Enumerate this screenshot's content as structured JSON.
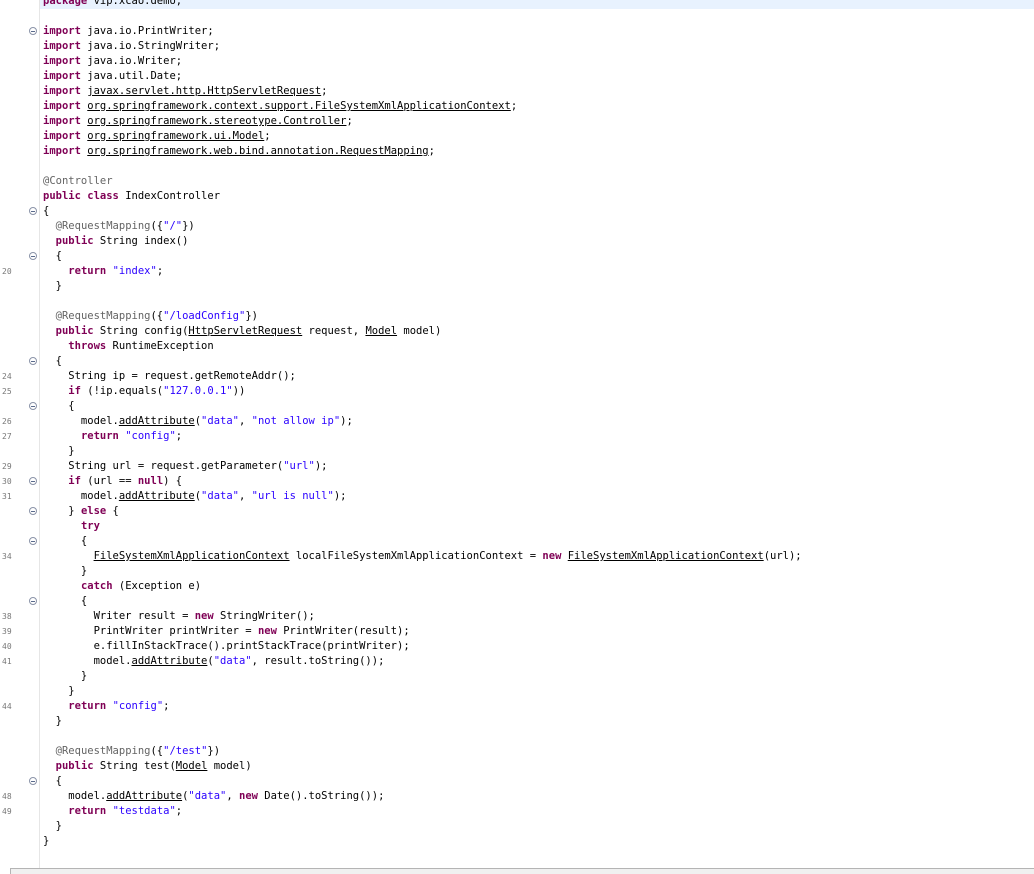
{
  "editor": {
    "lines": [
      {
        "n": "",
        "fold": false,
        "segs": [
          [
            "kw",
            "package"
          ],
          [
            "t",
            " vip.xcao.demo;"
          ]
        ]
      },
      {
        "n": "",
        "fold": false,
        "segs": []
      },
      {
        "n": "",
        "fold": true,
        "segs": [
          [
            "kw",
            "import"
          ],
          [
            "t",
            " java.io.PrintWriter;"
          ]
        ]
      },
      {
        "n": "",
        "fold": false,
        "segs": [
          [
            "kw",
            "import"
          ],
          [
            "t",
            " java.io.StringWriter;"
          ]
        ]
      },
      {
        "n": "",
        "fold": false,
        "segs": [
          [
            "kw",
            "import"
          ],
          [
            "t",
            " java.io.Writer;"
          ]
        ]
      },
      {
        "n": "",
        "fold": false,
        "segs": [
          [
            "kw",
            "import"
          ],
          [
            "t",
            " java.util.Date;"
          ]
        ]
      },
      {
        "n": "",
        "fold": false,
        "segs": [
          [
            "kw",
            "import"
          ],
          [
            "t",
            " "
          ],
          [
            "u",
            "javax.servlet.http.HttpServletRequest"
          ],
          [
            "t",
            ";"
          ]
        ]
      },
      {
        "n": "",
        "fold": false,
        "segs": [
          [
            "kw",
            "import"
          ],
          [
            "t",
            " "
          ],
          [
            "u",
            "org.springframework.context.support.FileSystemXmlApplicationContext"
          ],
          [
            "t",
            ";"
          ]
        ]
      },
      {
        "n": "",
        "fold": false,
        "segs": [
          [
            "kw",
            "import"
          ],
          [
            "t",
            " "
          ],
          [
            "u",
            "org.springframework.stereotype.Controller"
          ],
          [
            "t",
            ";"
          ]
        ]
      },
      {
        "n": "",
        "fold": false,
        "segs": [
          [
            "kw",
            "import"
          ],
          [
            "t",
            " "
          ],
          [
            "u",
            "org.springframework.ui.Model"
          ],
          [
            "t",
            ";"
          ]
        ]
      },
      {
        "n": "",
        "fold": false,
        "segs": [
          [
            "kw",
            "import"
          ],
          [
            "t",
            " "
          ],
          [
            "u",
            "org.springframework.web.bind.annotation.RequestMapping"
          ],
          [
            "t",
            ";"
          ]
        ]
      },
      {
        "n": "",
        "fold": false,
        "segs": []
      },
      {
        "n": "",
        "fold": false,
        "segs": [
          [
            "ann",
            "@Controller"
          ]
        ]
      },
      {
        "n": "",
        "fold": false,
        "segs": [
          [
            "kw",
            "public"
          ],
          [
            "t",
            " "
          ],
          [
            "kw",
            "class"
          ],
          [
            "t",
            " IndexController"
          ]
        ]
      },
      {
        "n": "",
        "fold": true,
        "segs": [
          [
            "t",
            "{"
          ]
        ]
      },
      {
        "n": "",
        "fold": false,
        "segs": [
          [
            "t",
            "  "
          ],
          [
            "ann",
            "@RequestMapping"
          ],
          [
            "t",
            "({"
          ],
          [
            "str",
            "\"/\""
          ],
          [
            "t",
            "})"
          ]
        ]
      },
      {
        "n": "",
        "fold": false,
        "segs": [
          [
            "t",
            "  "
          ],
          [
            "kw",
            "public"
          ],
          [
            "t",
            " String index()"
          ]
        ]
      },
      {
        "n": "",
        "fold": true,
        "segs": [
          [
            "t",
            "  {"
          ]
        ]
      },
      {
        "n": "20",
        "fold": false,
        "segs": [
          [
            "t",
            "    "
          ],
          [
            "kw",
            "return"
          ],
          [
            "t",
            " "
          ],
          [
            "str",
            "\"index\""
          ],
          [
            "t",
            ";"
          ]
        ]
      },
      {
        "n": "",
        "fold": false,
        "segs": [
          [
            "t",
            "  }"
          ]
        ]
      },
      {
        "n": "",
        "fold": false,
        "segs": []
      },
      {
        "n": "",
        "fold": false,
        "segs": [
          [
            "t",
            "  "
          ],
          [
            "ann",
            "@RequestMapping"
          ],
          [
            "t",
            "({"
          ],
          [
            "str",
            "\"/loadConfig\""
          ],
          [
            "t",
            "})"
          ]
        ]
      },
      {
        "n": "",
        "fold": false,
        "segs": [
          [
            "t",
            "  "
          ],
          [
            "kw",
            "public"
          ],
          [
            "t",
            " String config("
          ],
          [
            "u",
            "HttpServletRequest"
          ],
          [
            "t",
            " request, "
          ],
          [
            "u",
            "Model"
          ],
          [
            "t",
            " model)"
          ]
        ]
      },
      {
        "n": "",
        "fold": false,
        "segs": [
          [
            "t",
            "    "
          ],
          [
            "kw",
            "throws"
          ],
          [
            "t",
            " RuntimeException"
          ]
        ]
      },
      {
        "n": "",
        "fold": true,
        "segs": [
          [
            "t",
            "  {"
          ]
        ]
      },
      {
        "n": "24",
        "fold": false,
        "segs": [
          [
            "t",
            "    String ip = request.getRemoteAddr();"
          ]
        ]
      },
      {
        "n": "25",
        "fold": false,
        "segs": [
          [
            "t",
            "    "
          ],
          [
            "kw",
            "if"
          ],
          [
            "t",
            " (!ip.equals("
          ],
          [
            "str",
            "\"127.0.0.1\""
          ],
          [
            "t",
            "))"
          ]
        ]
      },
      {
        "n": "",
        "fold": true,
        "segs": [
          [
            "t",
            "    {"
          ]
        ]
      },
      {
        "n": "26",
        "fold": false,
        "segs": [
          [
            "t",
            "      model."
          ],
          [
            "u",
            "addAttribute"
          ],
          [
            "t",
            "("
          ],
          [
            "str",
            "\"data\""
          ],
          [
            "t",
            ", "
          ],
          [
            "str",
            "\"not allow ip\""
          ],
          [
            "t",
            ");"
          ]
        ]
      },
      {
        "n": "27",
        "fold": false,
        "segs": [
          [
            "t",
            "      "
          ],
          [
            "kw",
            "return"
          ],
          [
            "t",
            " "
          ],
          [
            "str",
            "\"config\""
          ],
          [
            "t",
            ";"
          ]
        ]
      },
      {
        "n": "",
        "fold": false,
        "segs": [
          [
            "t",
            "    }"
          ]
        ]
      },
      {
        "n": "29",
        "fold": false,
        "segs": [
          [
            "t",
            "    String url = request.getParameter("
          ],
          [
            "str",
            "\"url\""
          ],
          [
            "t",
            ");"
          ]
        ]
      },
      {
        "n": "30",
        "fold": true,
        "segs": [
          [
            "t",
            "    "
          ],
          [
            "kw",
            "if"
          ],
          [
            "t",
            " (url == "
          ],
          [
            "kw",
            "null"
          ],
          [
            "t",
            ") {"
          ]
        ]
      },
      {
        "n": "31",
        "fold": false,
        "segs": [
          [
            "t",
            "      model."
          ],
          [
            "u",
            "addAttribute"
          ],
          [
            "t",
            "("
          ],
          [
            "str",
            "\"data\""
          ],
          [
            "t",
            ", "
          ],
          [
            "str",
            "\"url is null\""
          ],
          [
            "t",
            ");"
          ]
        ]
      },
      {
        "n": "",
        "fold": true,
        "segs": [
          [
            "t",
            "    } "
          ],
          [
            "kw",
            "else"
          ],
          [
            "t",
            " {"
          ]
        ]
      },
      {
        "n": "",
        "fold": false,
        "segs": [
          [
            "t",
            "      "
          ],
          [
            "kw",
            "try"
          ]
        ]
      },
      {
        "n": "",
        "fold": true,
        "segs": [
          [
            "t",
            "      {"
          ]
        ]
      },
      {
        "n": "34",
        "fold": false,
        "segs": [
          [
            "t",
            "        "
          ],
          [
            "u",
            "FileSystemXmlApplicationContext"
          ],
          [
            "t",
            " localFileSystemXmlApplicationContext = "
          ],
          [
            "kw",
            "new"
          ],
          [
            "t",
            " "
          ],
          [
            "u",
            "FileSystemXmlApplicationContext"
          ],
          [
            "t",
            "(url);"
          ]
        ]
      },
      {
        "n": "",
        "fold": false,
        "segs": [
          [
            "t",
            "      }"
          ]
        ]
      },
      {
        "n": "",
        "fold": false,
        "segs": [
          [
            "t",
            "      "
          ],
          [
            "kw",
            "catch"
          ],
          [
            "t",
            " (Exception e)"
          ]
        ]
      },
      {
        "n": "",
        "fold": true,
        "segs": [
          [
            "t",
            "      {"
          ]
        ]
      },
      {
        "n": "38",
        "fold": false,
        "segs": [
          [
            "t",
            "        Writer result = "
          ],
          [
            "kw",
            "new"
          ],
          [
            "t",
            " StringWriter();"
          ]
        ]
      },
      {
        "n": "39",
        "fold": false,
        "segs": [
          [
            "t",
            "        PrintWriter printWriter = "
          ],
          [
            "kw",
            "new"
          ],
          [
            "t",
            " PrintWriter(result);"
          ]
        ]
      },
      {
        "n": "40",
        "fold": false,
        "segs": [
          [
            "t",
            "        e.fillInStackTrace().printStackTrace(printWriter);"
          ]
        ]
      },
      {
        "n": "41",
        "fold": false,
        "segs": [
          [
            "t",
            "        model."
          ],
          [
            "u",
            "addAttribute"
          ],
          [
            "t",
            "("
          ],
          [
            "str",
            "\"data\""
          ],
          [
            "t",
            ", result.toString());"
          ]
        ]
      },
      {
        "n": "",
        "fold": false,
        "segs": [
          [
            "t",
            "      }"
          ]
        ]
      },
      {
        "n": "",
        "fold": false,
        "segs": [
          [
            "t",
            "    }"
          ]
        ]
      },
      {
        "n": "44",
        "fold": false,
        "segs": [
          [
            "t",
            "    "
          ],
          [
            "kw",
            "return"
          ],
          [
            "t",
            " "
          ],
          [
            "str",
            "\"config\""
          ],
          [
            "t",
            ";"
          ]
        ]
      },
      {
        "n": "",
        "fold": false,
        "segs": [
          [
            "t",
            "  }"
          ]
        ]
      },
      {
        "n": "",
        "fold": false,
        "segs": []
      },
      {
        "n": "",
        "fold": false,
        "segs": [
          [
            "t",
            "  "
          ],
          [
            "ann",
            "@RequestMapping"
          ],
          [
            "t",
            "({"
          ],
          [
            "str",
            "\"/test\""
          ],
          [
            "t",
            "})"
          ]
        ]
      },
      {
        "n": "",
        "fold": false,
        "segs": [
          [
            "t",
            "  "
          ],
          [
            "kw",
            "public"
          ],
          [
            "t",
            " String test("
          ],
          [
            "u",
            "Model"
          ],
          [
            "t",
            " model)"
          ]
        ]
      },
      {
        "n": "",
        "fold": true,
        "segs": [
          [
            "t",
            "  {"
          ]
        ]
      },
      {
        "n": "48",
        "fold": false,
        "segs": [
          [
            "t",
            "    model."
          ],
          [
            "u",
            "addAttribute"
          ],
          [
            "t",
            "("
          ],
          [
            "str",
            "\"data\""
          ],
          [
            "t",
            ", "
          ],
          [
            "kw",
            "new"
          ],
          [
            "t",
            " Date().toString());"
          ]
        ]
      },
      {
        "n": "49",
        "fold": false,
        "segs": [
          [
            "t",
            "    "
          ],
          [
            "kw",
            "return"
          ],
          [
            "t",
            " "
          ],
          [
            "str",
            "\"testdata\""
          ],
          [
            "t",
            ";"
          ]
        ]
      },
      {
        "n": "",
        "fold": false,
        "segs": [
          [
            "t",
            "  }"
          ]
        ]
      },
      {
        "n": "",
        "fold": false,
        "segs": [
          [
            "t",
            "}"
          ]
        ]
      }
    ]
  }
}
